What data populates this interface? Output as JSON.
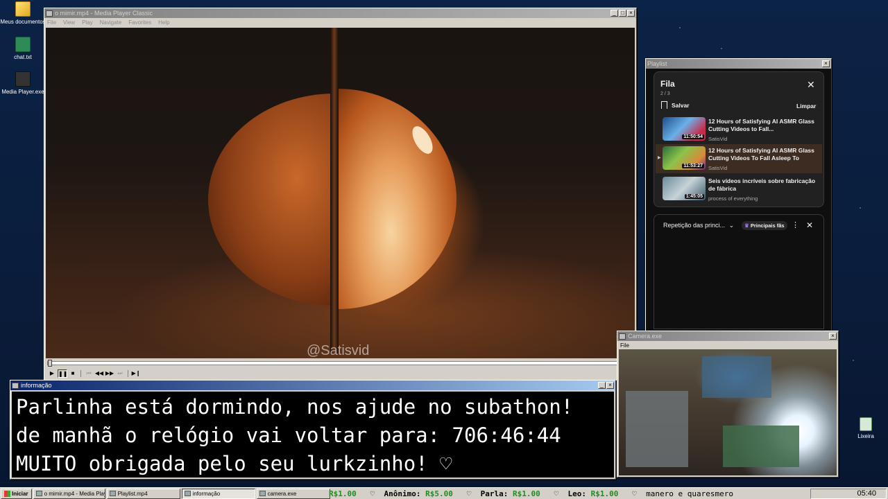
{
  "desktop": {
    "icons": [
      {
        "label": "Meus documentos",
        "icon": "folder-documents-icon"
      },
      {
        "label": "chat.txt",
        "icon": "text-file-icon"
      },
      {
        "label": "Media Player.exe",
        "icon": "media-player-icon"
      },
      {
        "label": "Lixeira",
        "icon": "recycle-bin-icon"
      }
    ]
  },
  "player": {
    "title": "o mimir.mp4 - Media Player Classic",
    "menu": [
      "File",
      "View",
      "Play",
      "Navigate",
      "Favorites",
      "Help"
    ],
    "watermark": "@Satisvid",
    "controls": [
      "play",
      "pause",
      "stop",
      "skip-back",
      "rewind",
      "fast-forward",
      "skip-forward",
      "frame-step"
    ],
    "progress": 0.0
  },
  "playlist": {
    "window_title": "Playlist",
    "queue_title": "Fila",
    "queue_position": "2 / 3",
    "save_label": "Salvar",
    "clear_label": "Limpar",
    "items": [
      {
        "title": "12 Hours of Satisfying AI ASMR Glass Cutting Videos to Fall...",
        "channel": "SatisVid",
        "duration": "11:50:54",
        "current": false
      },
      {
        "title": "12 Hours of Satisfying AI ASMR Glass Cutting Videos To Fall Asleep To",
        "channel": "SatisVid",
        "duration": "11:53:27",
        "current": true
      },
      {
        "title": "Seis vídeos incríveis sobre fabricação de fábrica",
        "channel": "process of everything",
        "duration": "1:45:05",
        "current": false
      }
    ],
    "repeat_label": "Repetição das princi...",
    "chip_label": "Principais fãs"
  },
  "info": {
    "title": "informação",
    "lines": [
      "Parlinha está dormindo, nos ajude no subathon!",
      "de manhã o relógio vai voltar para:  706:46:44",
      "MUITO obrigada pelo seu lurkzinho! ♡"
    ]
  },
  "camera": {
    "title": "Camera.exe",
    "menu_file": "File"
  },
  "taskbar": {
    "start_label": "Iniciar",
    "tasks": [
      {
        "label": "o mimir.mp4 - Media Playe...",
        "active": false
      },
      {
        "label": "Playlist.mp4",
        "active": false
      },
      {
        "label": "informação",
        "active": true
      },
      {
        "label": "camera.exe",
        "active": false
      }
    ],
    "ticker": [
      {
        "name": "",
        "amount": "R$1.00"
      },
      {
        "name": "Anônimo:",
        "amount": "R$5.00"
      },
      {
        "name": "Parla:",
        "amount": "R$1.00"
      },
      {
        "name": "Leo:",
        "amount": "R$1.00"
      }
    ],
    "ticker_tail": "manero e quaresmero",
    "clock": "05:40"
  },
  "colors": {
    "titlebar_active": "#0a246a",
    "titlebar_inactive": "#808080",
    "yt_panel": "#212121",
    "ticker_amount": "#228b22"
  }
}
